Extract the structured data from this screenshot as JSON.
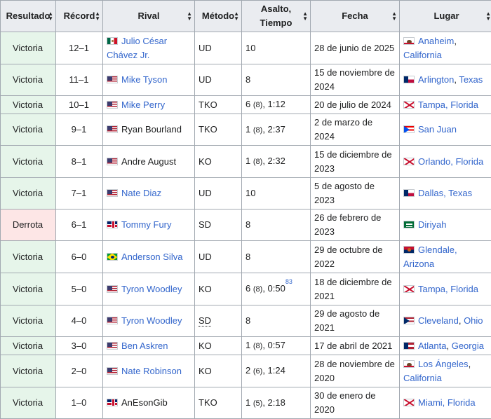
{
  "headers": {
    "resultado": "Resultado",
    "record": "Récord",
    "rival": "Rival",
    "metodo": "Método",
    "asalto_tiempo": "Asalto, Tiempo",
    "fecha": "Fecha",
    "lugar": "Lugar"
  },
  "sort_icon": "sort-arrows-icon",
  "colors": {
    "win_bg": "#e6f5ea",
    "loss_bg": "#fde6e6",
    "link": "#3366cc",
    "header_bg": "#eaecf0"
  },
  "rows": [
    {
      "resultado": "Victoria",
      "record": "12–1",
      "rival_flag": "mexico-flag",
      "rival": "Julio César Chávez Jr.",
      "metodo": "UD",
      "asalto": "10",
      "asalto_paren": "",
      "tiempo": "",
      "ref": "",
      "fecha": "28 de junio de 2025",
      "lugar_flag": "california-flag",
      "lugar_a": "Anaheim",
      "lugar_sep": ", ",
      "lugar_b": "California"
    },
    {
      "resultado": "Victoria",
      "record": "11–1",
      "rival_flag": "usa-flag",
      "rival": "Mike Tyson",
      "metodo": "UD",
      "asalto": "8",
      "asalto_paren": "",
      "tiempo": "",
      "ref": "",
      "fecha": "15 de noviembre de 2024",
      "lugar_flag": "texas-flag",
      "lugar_a": "Arlington",
      "lugar_sep": ", ",
      "lugar_b": "Texas"
    },
    {
      "resultado": "Victoria",
      "record": "10–1",
      "rival_flag": "usa-flag",
      "rival": "Mike Perry",
      "metodo": "TKO",
      "asalto": "6",
      "asalto_paren": "(8)",
      "tiempo": "1:12",
      "ref": "",
      "fecha": "20 de julio de 2024",
      "lugar_flag": "florida-flag",
      "lugar_a": "Tampa, Florida",
      "lugar_sep": "",
      "lugar_b": ""
    },
    {
      "resultado": "Victoria",
      "record": "9–1",
      "rival_flag": "usa-flag",
      "rival": "Ryan Bourland",
      "metodo": "TKO",
      "asalto": "1",
      "asalto_paren": "(8)",
      "tiempo": "2:37",
      "ref": "",
      "fecha": "2 de marzo de 2024",
      "lugar_flag": "puerto-rico-flag",
      "lugar_a": "San Juan",
      "lugar_sep": "",
      "lugar_b": ""
    },
    {
      "resultado": "Victoria",
      "record": "8–1",
      "rival_flag": "usa-flag",
      "rival": "Andre August",
      "metodo": "KO",
      "asalto": "1",
      "asalto_paren": "(8)",
      "tiempo": "2:32",
      "ref": "",
      "fecha": "15 de diciembre de 2023",
      "lugar_flag": "florida-flag",
      "lugar_a": "Orlando, Florida",
      "lugar_sep": "",
      "lugar_b": ""
    },
    {
      "resultado": "Victoria",
      "record": "7–1",
      "rival_flag": "usa-flag",
      "rival": "Nate Diaz",
      "metodo": "UD",
      "asalto": "10",
      "asalto_paren": "",
      "tiempo": "",
      "ref": "",
      "fecha": "5 de agosto de 2023",
      "lugar_flag": "texas-flag",
      "lugar_a": "Dallas, Texas",
      "lugar_sep": "",
      "lugar_b": ""
    },
    {
      "resultado": "Derrota",
      "record": "6–1",
      "rival_flag": "uk-flag",
      "rival": "Tommy Fury",
      "metodo": "SD",
      "asalto": "8",
      "asalto_paren": "",
      "tiempo": "",
      "ref": "",
      "fecha": "26 de febrero de 2023",
      "lugar_flag": "saudi-arabia-flag",
      "lugar_a": "Diriyah",
      "lugar_sep": "",
      "lugar_b": ""
    },
    {
      "resultado": "Victoria",
      "record": "6–0",
      "rival_flag": "brazil-flag",
      "rival": "Anderson Silva",
      "metodo": "UD",
      "asalto": "8",
      "asalto_paren": "",
      "tiempo": "",
      "ref": "",
      "fecha": "29 de octubre de 2022",
      "lugar_flag": "arizona-flag",
      "lugar_a": "Glendale, Arizona",
      "lugar_sep": "",
      "lugar_b": ""
    },
    {
      "resultado": "Victoria",
      "record": "5–0",
      "rival_flag": "usa-flag",
      "rival": "Tyron Woodley",
      "metodo": "KO",
      "asalto": "6",
      "asalto_paren": "(8)",
      "tiempo": "0:50",
      "ref": "83",
      "fecha": "18 de diciembre de 2021",
      "lugar_flag": "florida-flag",
      "lugar_a": "Tampa, Florida",
      "lugar_sep": "",
      "lugar_b": ""
    },
    {
      "resultado": "Victoria",
      "record": "4–0",
      "rival_flag": "usa-flag",
      "rival": "Tyron Woodley",
      "metodo": "SD",
      "asalto": "8",
      "asalto_paren": "",
      "tiempo": "",
      "ref": "",
      "fecha": "29 de agosto de 2021",
      "lugar_flag": "ohio-flag",
      "lugar_a": "Cleveland",
      "lugar_sep": ", ",
      "lugar_b": "Ohio"
    },
    {
      "resultado": "Victoria",
      "record": "3–0",
      "rival_flag": "usa-flag",
      "rival": "Ben Askren",
      "metodo": "KO",
      "asalto": "1",
      "asalto_paren": "(8)",
      "tiempo": "0:57",
      "ref": "",
      "fecha": "17 de abril de 2021",
      "lugar_flag": "georgia-flag",
      "lugar_a": "Atlanta",
      "lugar_sep": ", ",
      "lugar_b": "Georgia"
    },
    {
      "resultado": "Victoria",
      "record": "2–0",
      "rival_flag": "usa-flag",
      "rival": "Nate Robinson",
      "metodo": "KO",
      "asalto": "2",
      "asalto_paren": "(6)",
      "tiempo": "1:24",
      "ref": "",
      "fecha": "28 de noviembre de 2020",
      "lugar_flag": "california-flag",
      "lugar_a": "Los Ángeles",
      "lugar_sep": ", ",
      "lugar_b": "California"
    },
    {
      "resultado": "Victoria",
      "record": "1–0",
      "rival_flag": "uk-flag",
      "rival": "AnEsonGib",
      "metodo": "TKO",
      "asalto": "1",
      "asalto_paren": "(5)",
      "tiempo": "2:18",
      "ref": "",
      "fecha": "30 de enero de 2020",
      "lugar_flag": "florida-flag",
      "lugar_a": "Miami, Florida",
      "lugar_sep": "",
      "lugar_b": ""
    }
  ]
}
